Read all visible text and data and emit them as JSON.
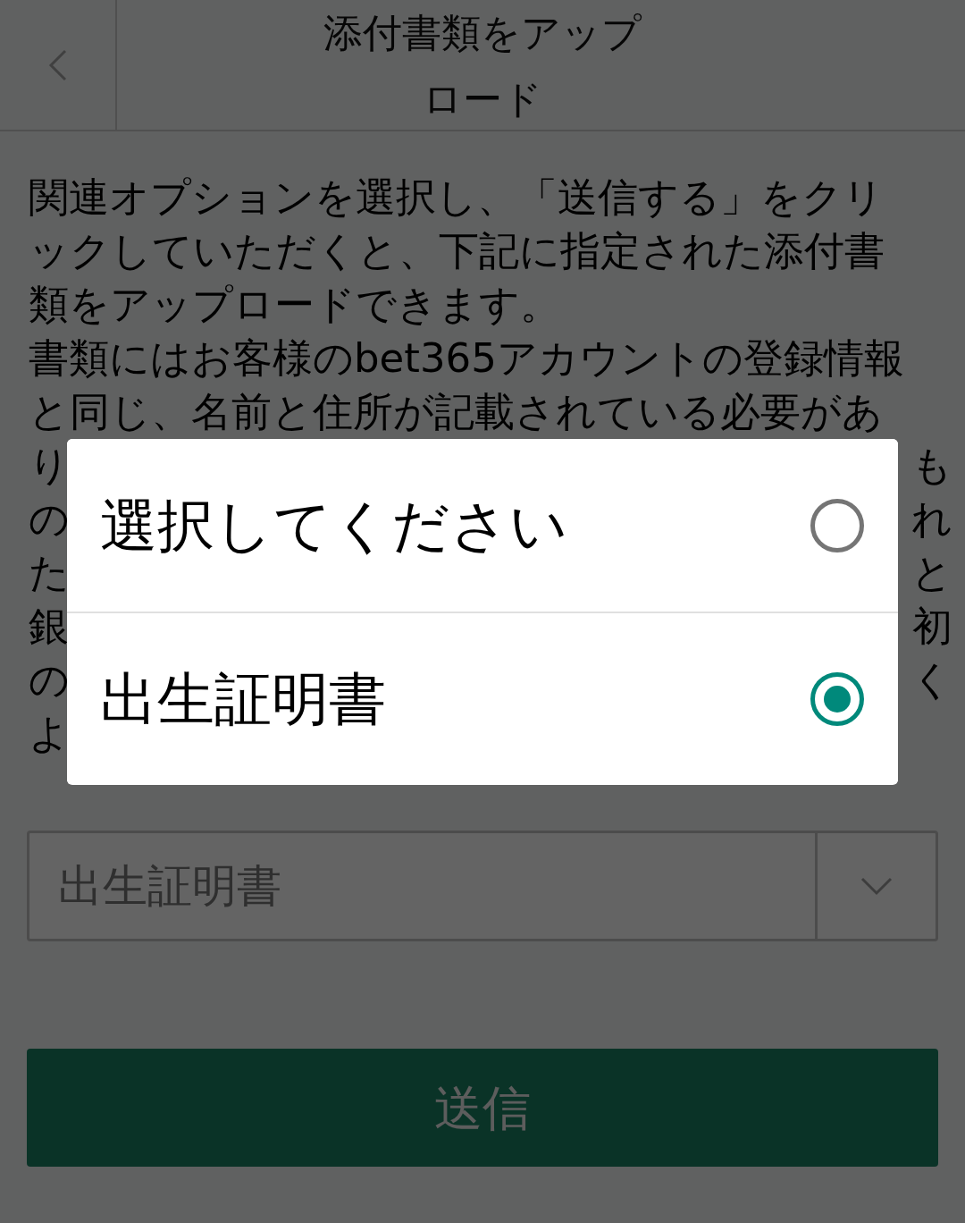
{
  "header": {
    "title": "添付書類をアップロード"
  },
  "intro": {
    "lines": [
      "関連オプションを選択し、「送信する」をクリ",
      "ックしていただくと、下記に指定された添付書",
      "類をアップロードできます。",
      "書類にはお客様のbet365アカウントの登録情報",
      "と同じ、名前と住所が記載されている必要があ"
    ],
    "partly_covered_lines": [
      {
        "left": "り",
        "right": "も"
      },
      {
        "left": "の",
        "right": "れ"
      },
      {
        "left": "た",
        "right": "と"
      },
      {
        "left": "銀",
        "right": "初"
      },
      {
        "left": "の",
        "right": "く"
      },
      {
        "left": "よ"
      }
    ]
  },
  "document_select": {
    "value": "出生証明書"
  },
  "submit_button": {
    "label": "送信"
  },
  "dialog": {
    "options": [
      {
        "label": "選択してください",
        "selected": false
      },
      {
        "label": "出生証明書",
        "selected": true
      }
    ]
  }
}
